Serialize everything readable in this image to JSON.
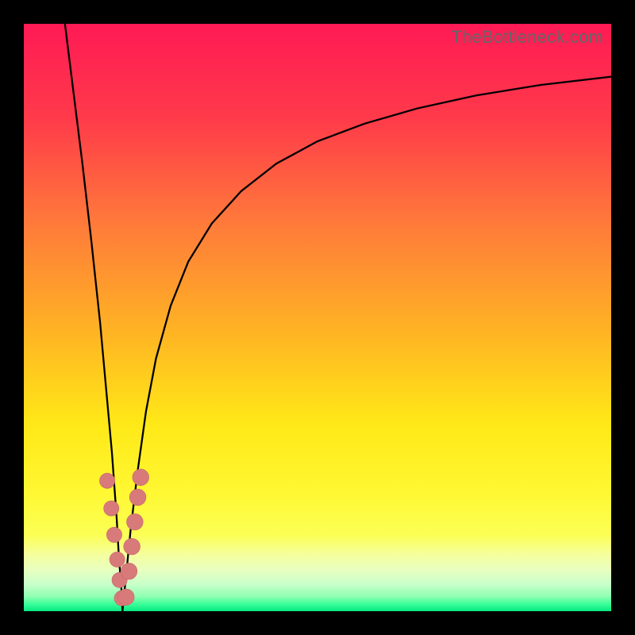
{
  "watermark": "TheBottleneck.com",
  "colors": {
    "frame": "#000000",
    "curve": "#000000",
    "marker_fill": "#d87a7a",
    "marker_stroke": "#c46868",
    "gradient_stops": [
      {
        "offset": 0.0,
        "color": "#ff1a55"
      },
      {
        "offset": 0.16,
        "color": "#ff3a4a"
      },
      {
        "offset": 0.34,
        "color": "#ff7a3a"
      },
      {
        "offset": 0.52,
        "color": "#ffb224"
      },
      {
        "offset": 0.68,
        "color": "#ffe817"
      },
      {
        "offset": 0.8,
        "color": "#fff833"
      },
      {
        "offset": 0.87,
        "color": "#fbff55"
      },
      {
        "offset": 0.905,
        "color": "#f5ffa0"
      },
      {
        "offset": 0.93,
        "color": "#e8ffc0"
      },
      {
        "offset": 0.955,
        "color": "#c7ffca"
      },
      {
        "offset": 0.975,
        "color": "#8effb0"
      },
      {
        "offset": 0.988,
        "color": "#3aff99"
      },
      {
        "offset": 1.0,
        "color": "#06e880"
      }
    ]
  },
  "chart_data": {
    "type": "line",
    "title": "",
    "xlabel": "",
    "ylabel": "",
    "xlim": [
      0,
      100
    ],
    "ylim": [
      0,
      100
    ],
    "grid": false,
    "legend_position": "none",
    "series": [
      {
        "name": "bottleneck-curve-left",
        "x": [
          7.0,
          8.5,
          10.0,
          11.5,
          13.0,
          14.0,
          15.0,
          15.8,
          16.2,
          16.6,
          16.8
        ],
        "values": [
          100,
          88,
          76,
          63,
          49,
          38,
          27,
          16,
          9,
          4,
          0
        ]
      },
      {
        "name": "bottleneck-curve-right",
        "x": [
          16.8,
          17.4,
          18.2,
          19.4,
          20.8,
          22.5,
          25.0,
          28.0,
          32.0,
          37.0,
          43.0,
          50.0,
          58.0,
          67.0,
          77.0,
          88.0,
          100.0
        ],
        "values": [
          0,
          6,
          14,
          24,
          34,
          43,
          52,
          59.5,
          66,
          71.5,
          76.2,
          80.0,
          83.0,
          85.6,
          87.8,
          89.6,
          91.0
        ]
      }
    ],
    "markers": [
      {
        "series": "left",
        "x": 14.2,
        "y": 22.2,
        "r": 1.3
      },
      {
        "series": "left",
        "x": 14.9,
        "y": 17.5,
        "r": 1.3
      },
      {
        "series": "left",
        "x": 15.4,
        "y": 13.0,
        "r": 1.3
      },
      {
        "series": "left",
        "x": 15.9,
        "y": 8.8,
        "r": 1.3
      },
      {
        "series": "left",
        "x": 16.3,
        "y": 5.3,
        "r": 1.3
      },
      {
        "series": "left",
        "x": 16.7,
        "y": 2.2,
        "r": 1.3
      },
      {
        "series": "right",
        "x": 17.4,
        "y": 2.4,
        "r": 1.4
      },
      {
        "series": "right",
        "x": 17.9,
        "y": 6.8,
        "r": 1.4
      },
      {
        "series": "right",
        "x": 18.4,
        "y": 11.0,
        "r": 1.4
      },
      {
        "series": "right",
        "x": 18.9,
        "y": 15.2,
        "r": 1.4
      },
      {
        "series": "right",
        "x": 19.4,
        "y": 19.4,
        "r": 1.4
      },
      {
        "series": "right",
        "x": 19.9,
        "y": 22.8,
        "r": 1.4
      }
    ],
    "annotations": []
  }
}
